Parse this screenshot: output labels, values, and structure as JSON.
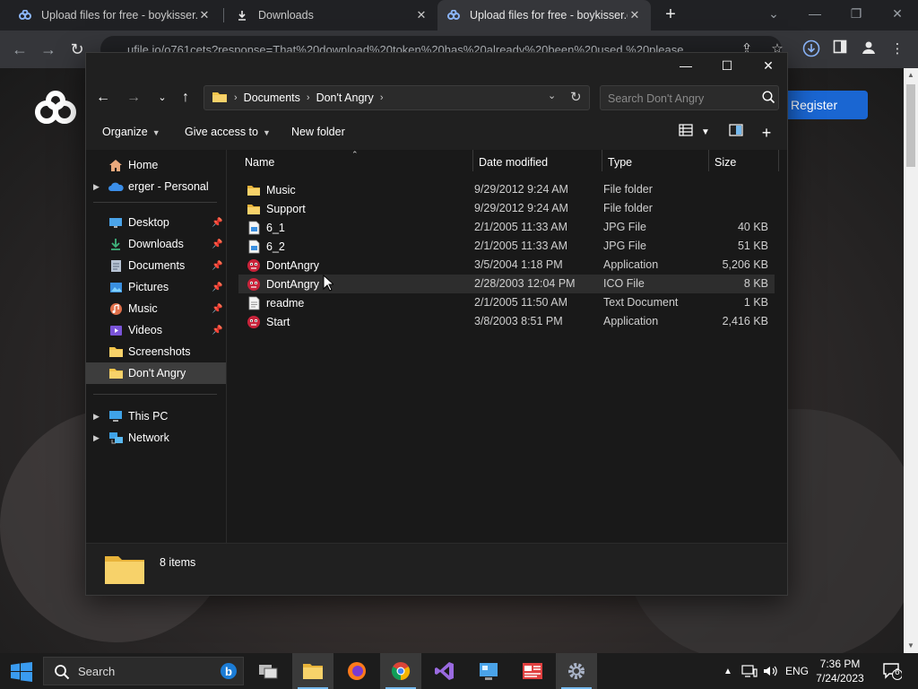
{
  "browser": {
    "tabs": [
      {
        "label": "Upload files for free - boykisser.g",
        "active": false
      },
      {
        "label": "Downloads",
        "active": false
      },
      {
        "label": "Upload files for free - boykisser.g",
        "active": true
      }
    ],
    "url": "ufile.io/o761cets?response=That%20download%20token%20has%20already%20been%20used.%20please"
  },
  "webpage": {
    "register_label": "Register"
  },
  "explorer": {
    "breadcrumbs": [
      "Documents",
      "Don't Angry"
    ],
    "search_placeholder": "Search Don't Angry",
    "commands": {
      "organize": "Organize",
      "give_access": "Give access to",
      "new_folder": "New folder"
    },
    "nav_pane": {
      "top": [
        {
          "label": "Home",
          "icon": "home-icon"
        },
        {
          "label": "erger - Personal",
          "icon": "onedrive-cloud-icon"
        }
      ],
      "quick_access": [
        {
          "label": "Desktop",
          "icon": "desktop-icon",
          "pinned": true
        },
        {
          "label": "Downloads",
          "icon": "download-arrow-icon",
          "pinned": true
        },
        {
          "label": "Documents",
          "icon": "document-icon",
          "pinned": true
        },
        {
          "label": "Pictures",
          "icon": "pictures-icon",
          "pinned": true
        },
        {
          "label": "Music",
          "icon": "music-icon",
          "pinned": true
        },
        {
          "label": "Videos",
          "icon": "videos-icon",
          "pinned": true
        },
        {
          "label": "Screenshots",
          "icon": "folder-icon",
          "pinned": false
        },
        {
          "label": "Don't Angry",
          "icon": "folder-icon",
          "pinned": false,
          "selected": true
        }
      ],
      "bottom": [
        {
          "label": "This PC",
          "icon": "this-pc-icon"
        },
        {
          "label": "Network",
          "icon": "network-icon"
        }
      ]
    },
    "columns": {
      "name": "Name",
      "date": "Date modified",
      "type": "Type",
      "size": "Size"
    },
    "files": [
      {
        "name": "Music",
        "date": "9/29/2012 9:24 AM",
        "type": "File folder",
        "size": "",
        "icon": "folder-icon"
      },
      {
        "name": "Support",
        "date": "9/29/2012 9:24 AM",
        "type": "File folder",
        "size": "",
        "icon": "folder-icon"
      },
      {
        "name": "6_1",
        "date": "2/1/2005 11:33 AM",
        "type": "JPG File",
        "size": "40 KB",
        "icon": "image-file-icon"
      },
      {
        "name": "6_2",
        "date": "2/1/2005 11:33 AM",
        "type": "JPG File",
        "size": "51 KB",
        "icon": "image-file-icon"
      },
      {
        "name": "DontAngry",
        "date": "3/5/2004 1:18 PM",
        "type": "Application",
        "size": "5,206 KB",
        "icon": "app-face-icon"
      },
      {
        "name": "DontAngry",
        "date": "2/28/2003 12:04 PM",
        "type": "ICO File",
        "size": "8 KB",
        "icon": "app-face-icon"
      },
      {
        "name": "readme",
        "date": "2/1/2005 11:50 AM",
        "type": "Text Document",
        "size": "1 KB",
        "icon": "text-file-icon"
      },
      {
        "name": "Start",
        "date": "3/8/2003 8:51 PM",
        "type": "Application",
        "size": "2,416 KB",
        "icon": "app-face-icon"
      }
    ],
    "item_count": "8 items"
  },
  "taskbar": {
    "search_label": "Search",
    "language": "ENG",
    "time": "7:36 PM",
    "date": "7/24/2023",
    "notification_count": "6"
  },
  "colors": {
    "accent": "#1a66d2",
    "folder": "#f4c54b",
    "explorer_bg": "#191919"
  }
}
